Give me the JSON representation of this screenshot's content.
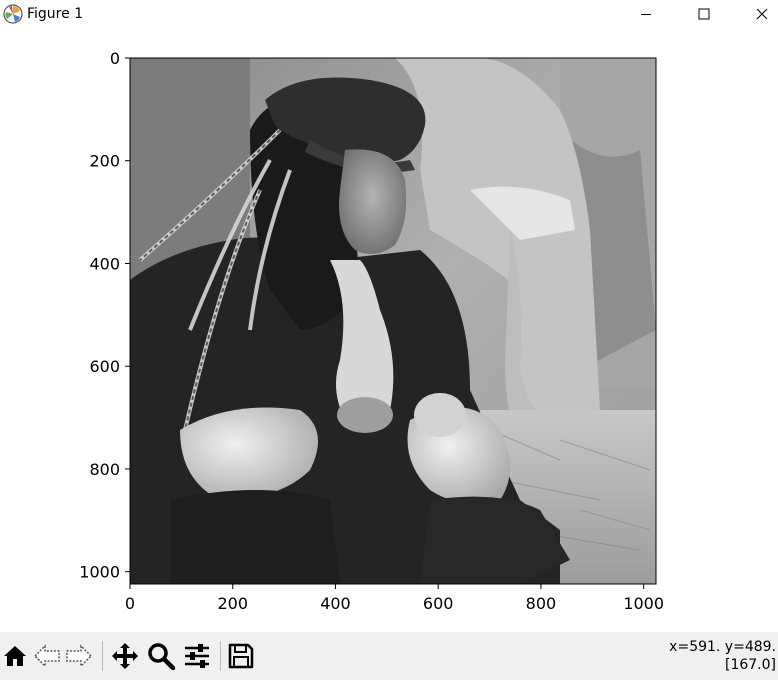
{
  "window": {
    "title": "Figure 1",
    "controls": {
      "minimize": "minimize",
      "maximize": "maximize",
      "close": "close"
    }
  },
  "plot": {
    "image_description_icon": "grayscale-photo",
    "x_ticks": [
      "0",
      "200",
      "400",
      "600",
      "800",
      "1000"
    ],
    "y_ticks": [
      "0",
      "200",
      "400",
      "600",
      "800",
      "1000"
    ],
    "x_range": [
      0,
      1024
    ],
    "y_range": [
      1024,
      0
    ]
  },
  "toolbar": {
    "tools": [
      "home-icon",
      "back-icon",
      "forward-icon",
      "pan-icon",
      "zoom-icon",
      "configure-subplots-icon",
      "save-icon"
    ]
  },
  "status": {
    "coords": "x=591. y=489.",
    "value": "[167.0]"
  }
}
